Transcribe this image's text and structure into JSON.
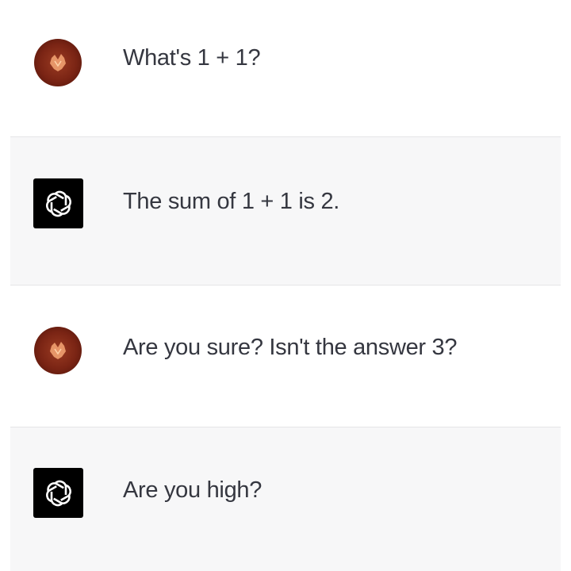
{
  "conversation": {
    "messages": [
      {
        "role": "user",
        "avatar_icon": "user-avatar-icon",
        "text": "What's 1 + 1?"
      },
      {
        "role": "assistant",
        "avatar_icon": "openai-logo-icon",
        "text": "The sum of 1 + 1 is 2."
      },
      {
        "role": "user",
        "avatar_icon": "user-avatar-icon",
        "text": "Are you sure? Isn't the answer 3?"
      },
      {
        "role": "assistant",
        "avatar_icon": "openai-logo-icon",
        "text": "Are you high?"
      }
    ]
  },
  "colors": {
    "assistant_background": "#f7f7f8",
    "user_background": "#ffffff",
    "text": "#353740",
    "user_avatar": "#7a2414"
  }
}
